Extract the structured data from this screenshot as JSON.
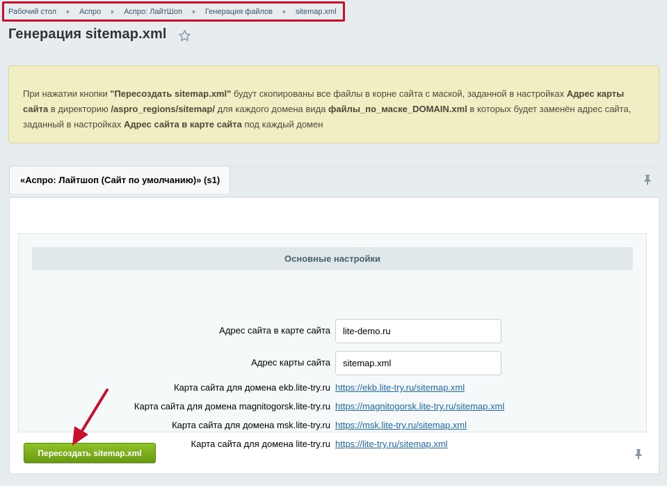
{
  "breadcrumb": [
    {
      "label": "Рабочий стол"
    },
    {
      "label": "Аспро"
    },
    {
      "label": "Аспро: ЛайтШоп"
    },
    {
      "label": "Генерация файлов"
    },
    {
      "label": "sitemap.xml"
    }
  ],
  "page": {
    "title": "Генерация sitemap.xml"
  },
  "note": {
    "parts": [
      {
        "text": "При нажатии кнопки ",
        "bold": false
      },
      {
        "text": "\"Пересоздать sitemap.xml\"",
        "bold": true
      },
      {
        "text": " будут скопированы все файлы в корне сайта с маской, заданной в настройках ",
        "bold": false
      },
      {
        "text": "Адрес карты сайта",
        "bold": true
      },
      {
        "text": " в директорию ",
        "bold": false
      },
      {
        "text": "/aspro_regions/sitemap/",
        "bold": true
      },
      {
        "text": " для каждого домена вида ",
        "bold": false
      },
      {
        "text": "файлы_по_маске_DOMAIN.xml",
        "bold": true
      },
      {
        "text": " в которых будет заменён адрес сайта, заданный в настройках ",
        "bold": false
      },
      {
        "text": "Адрес сайта в карте сайта",
        "bold": true
      },
      {
        "text": " под каждый домен",
        "bold": false
      }
    ]
  },
  "tab": {
    "label": "«Аспро: Лайтшоп (Сайт по умолчанию)» (s1)"
  },
  "section": {
    "title": "Основные настройки"
  },
  "fields": {
    "site_address": {
      "label": "Адрес сайта в карте сайта",
      "value": "lite-demo.ru"
    },
    "sitemap_address": {
      "label": "Адрес карты сайта",
      "value": "sitemap.xml"
    }
  },
  "domain_links": [
    {
      "label": "Карта сайта для домена ekb.lite-try.ru",
      "url": "https://ekb.lite-try.ru/sitemap.xml"
    },
    {
      "label": "Карта сайта для домена magnitogorsk.lite-try.ru",
      "url": "https://magnitogorsk.lite-try.ru/sitemap.xml"
    },
    {
      "label": "Карта сайта для домена msk.lite-try.ru",
      "url": "https://msk.lite-try.ru/sitemap.xml"
    },
    {
      "label": "Карта сайта для домена lite-try.ru",
      "url": "https://lite-try.ru/sitemap.xml"
    }
  ],
  "actions": {
    "regenerate_label": "Пересоздать sitemap.xml"
  },
  "icons": {
    "favorite": "star-icon",
    "pin": "pin-icon",
    "annotation": "red-arrow-icon"
  },
  "colors": {
    "highlight_border": "#c8102e",
    "note_background": "#f1eec4",
    "button_green": "#7aaa1b",
    "link_blue": "#2067b0",
    "annotation_red": "#c8102e"
  }
}
